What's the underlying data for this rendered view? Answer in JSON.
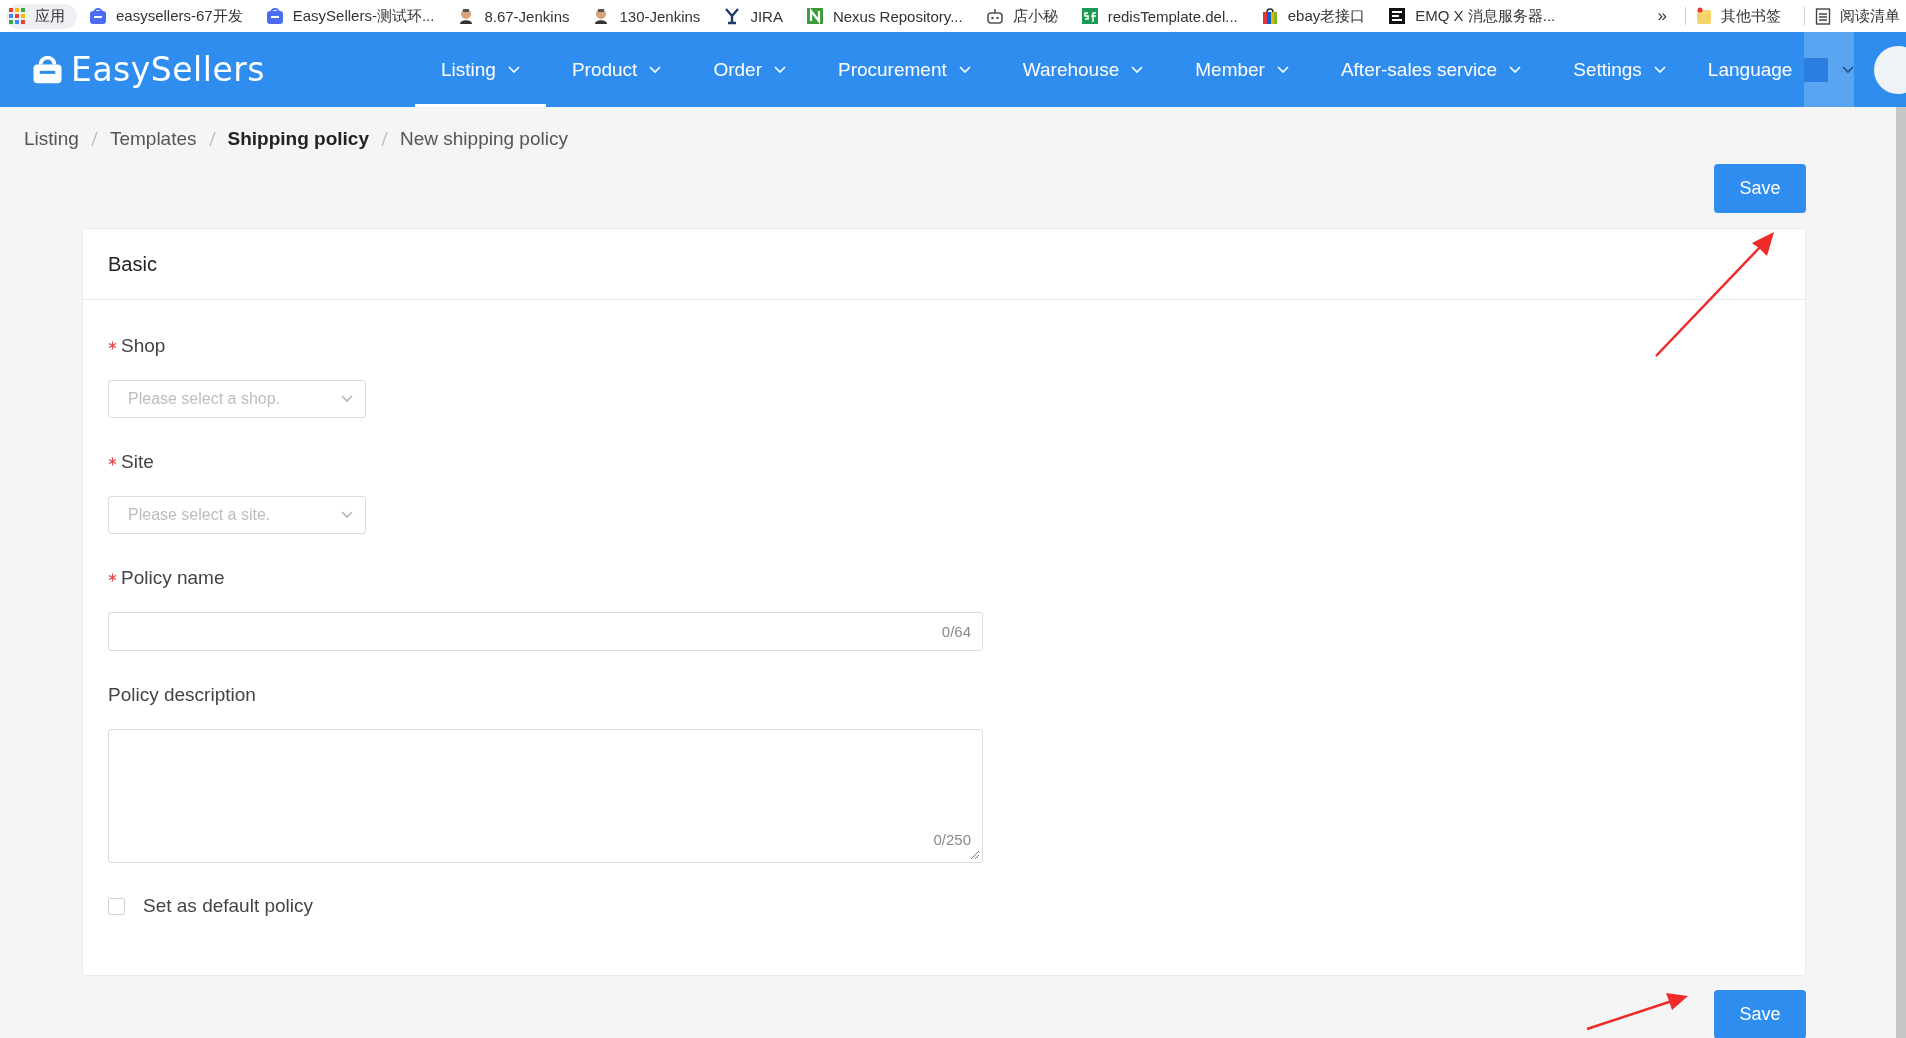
{
  "bookmarks_bar": {
    "apps": "应用",
    "items": [
      {
        "label": "easysellers-67开发"
      },
      {
        "label": "EasySellers-测试环..."
      },
      {
        "label": "8.67-Jenkins"
      },
      {
        "label": "130-Jenkins"
      },
      {
        "label": "JIRA"
      },
      {
        "label": "Nexus Repository..."
      },
      {
        "label": "店小秘"
      },
      {
        "label": "redisTemplate.del..."
      },
      {
        "label": "ebay老接口"
      },
      {
        "label": "EMQ X 消息服务器..."
      }
    ],
    "overflow": "»",
    "other_bookmarks": "其他书签",
    "reading_list": "阅读清单"
  },
  "nav": {
    "logo": "EasySellers",
    "menu": [
      {
        "label": "Listing",
        "selected": true
      },
      {
        "label": "Product",
        "selected": false
      },
      {
        "label": "Order",
        "selected": false
      },
      {
        "label": "Procurement",
        "selected": false
      },
      {
        "label": "Warehouse",
        "selected": false
      },
      {
        "label": "Member",
        "selected": false
      },
      {
        "label": "After-sales service",
        "selected": false
      },
      {
        "label": "Settings",
        "selected": false
      }
    ],
    "language": "Language"
  },
  "breadcrumb": [
    {
      "label": "Listing",
      "emphasized": false
    },
    {
      "label": "Templates",
      "emphasized": false
    },
    {
      "label": "Shipping policy",
      "emphasized": true
    },
    {
      "label": "New shipping policy",
      "emphasized": false
    }
  ],
  "top_save": "Save",
  "card": {
    "title": "Basic",
    "fields": [
      {
        "kind": "select",
        "label": "Shop",
        "required": true,
        "placeholder": "Please select a shop."
      },
      {
        "kind": "select",
        "label": "Site",
        "required": true,
        "placeholder": "Please select a site."
      },
      {
        "kind": "input",
        "label": "Policy name",
        "required": true,
        "counter": "0/64"
      },
      {
        "kind": "textarea",
        "label": "Policy description",
        "required": false,
        "counter": "0/250"
      }
    ],
    "default_policy": {
      "label": "Set as default policy",
      "checked": false
    }
  },
  "bottom_save": "Save"
}
